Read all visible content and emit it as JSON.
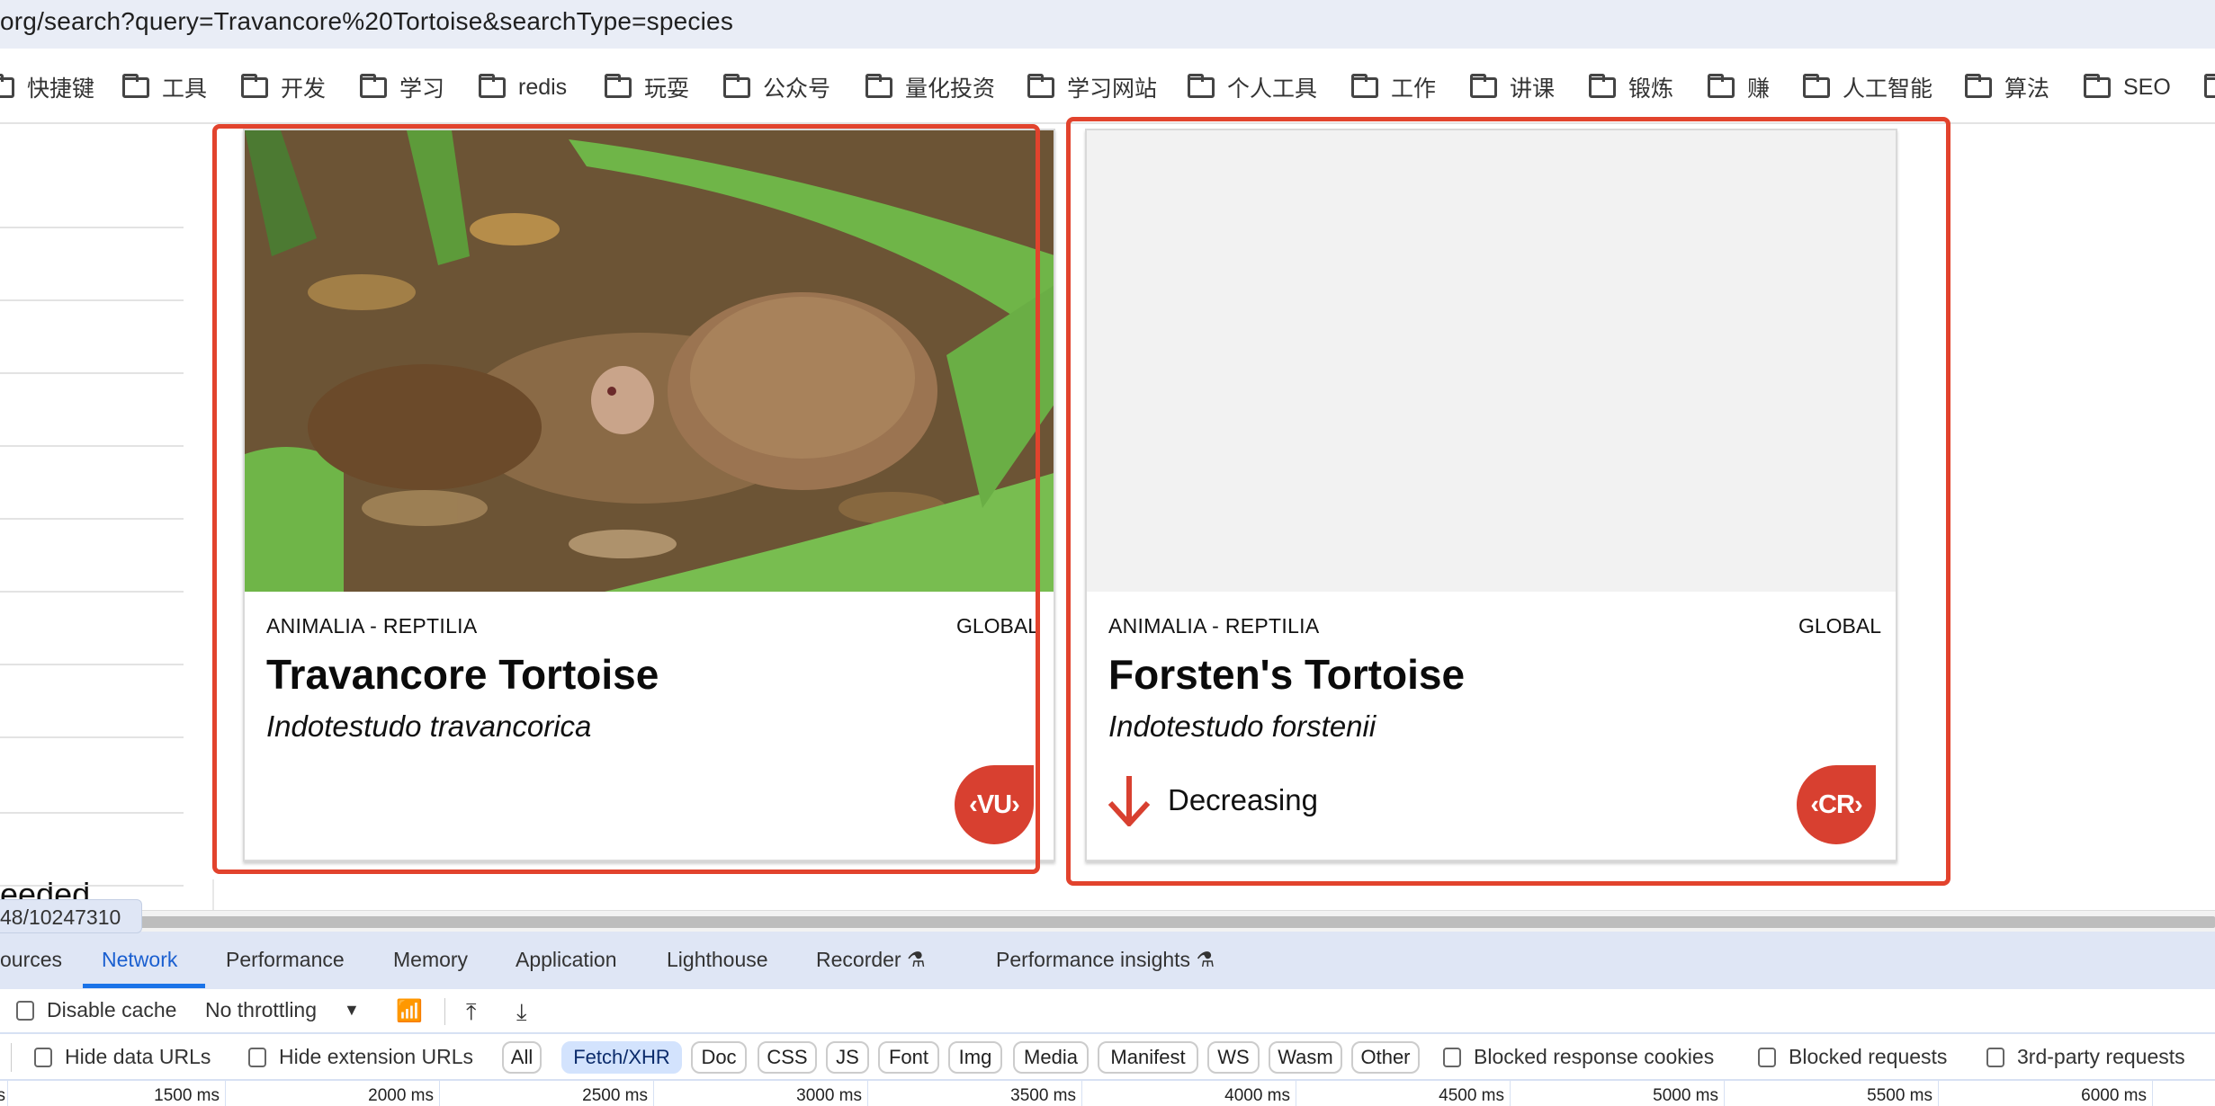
{
  "browser": {
    "url": "org/search?query=Travancore%20Tortoise&searchType=species",
    "bookmarks": [
      "快捷键",
      "工具",
      "开发",
      "学习",
      "redis",
      "玩耍",
      "公众号",
      "量化投资",
      "学习网站",
      "个人工具",
      "工作",
      "讲课",
      "锻炼",
      "赚",
      "人工智能",
      "算法",
      "SEO"
    ]
  },
  "page": {
    "sidebar_partial_text": "eeded",
    "cards": [
      {
        "kingdom_class": "ANIMALIA - REPTILIA",
        "scope": "GLOBAL",
        "common_name": "Travancore Tortoise",
        "scientific_name": "Indotestudo travancorica",
        "category": "VU",
        "trend": null,
        "has_image": true
      },
      {
        "kingdom_class": "ANIMALIA - REPTILIA",
        "scope": "GLOBAL",
        "common_name": "Forsten's Tortoise",
        "scientific_name": "Indotestudo forstenii",
        "category": "CR",
        "trend": "Decreasing",
        "has_image": false
      }
    ],
    "badge_color": "#d84030",
    "highlight_color": "#e2432d"
  },
  "status_tooltip": "48/10247310",
  "devtools": {
    "tabs": [
      "ources",
      "Network",
      "Performance",
      "Memory",
      "Application",
      "Lighthouse",
      "Recorder",
      "Performance insights"
    ],
    "active_tab": "Network",
    "toolbar": {
      "disable_cache": "Disable cache",
      "throttling": "No throttling"
    },
    "filters": {
      "hide_data_urls": "Hide data URLs",
      "hide_extension_urls": "Hide extension URLs",
      "types": [
        "All",
        "Fetch/XHR",
        "Doc",
        "CSS",
        "JS",
        "Font",
        "Img",
        "Media",
        "Manifest",
        "WS",
        "Wasm",
        "Other"
      ],
      "active_type": "Fetch/XHR",
      "blocked_response_cookies": "Blocked response cookies",
      "blocked_requests": "Blocked requests",
      "third_party": "3rd-party requests"
    },
    "timeline_ticks": [
      "s",
      "1500 ms",
      "2000 ms",
      "2500 ms",
      "3000 ms",
      "3500 ms",
      "4000 ms",
      "4500 ms",
      "5000 ms",
      "5500 ms",
      "6000 ms"
    ]
  }
}
